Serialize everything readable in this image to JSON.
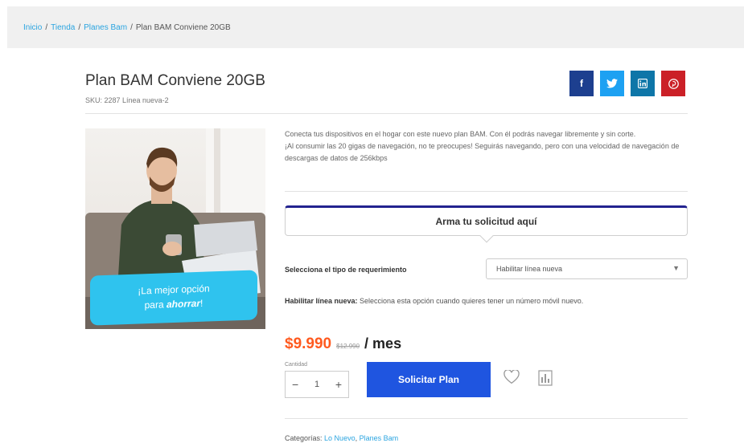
{
  "breadcrumb": {
    "items": [
      "Inicio",
      "Tienda",
      "Planes Bam"
    ],
    "current": "Plan BAM Conviene 20GB",
    "separator": "/"
  },
  "product": {
    "title": "Plan BAM Conviene 20GB",
    "sku": "SKU: 2287 Línea nueva-2",
    "description": [
      "Conecta tus dispositivos en el hogar con este nuevo plan BAM.  Con él podrás navegar libremente y sin corte.",
      "¡Al consumir las 20 gigas de navegación, no te preocupes!  Seguirás navegando, pero con una velocidad de navegación de descargas de datos de 256kbps"
    ]
  },
  "share": [
    {
      "icon": "facebook-icon",
      "glyph": "f",
      "color": "#1d3f8f"
    },
    {
      "icon": "twitter-icon",
      "glyph": "t",
      "color": "#1da1f2"
    },
    {
      "icon": "linkedin-icon",
      "glyph": "in",
      "color": "#0e76a8"
    },
    {
      "icon": "pinterest-icon",
      "glyph": "p",
      "color": "#cb2027"
    }
  ],
  "hero_banner": {
    "line1": "¡La mejor opción",
    "line2_prefix": "para ",
    "line2_emph": "ahorrar",
    "line2_suffix": "!"
  },
  "request": {
    "header": "Arma tu solicitud aquí",
    "type_label": "Selecciona el tipo de requerimiento",
    "type_value": "Habilitar línea nueva",
    "hint_title": "Habilitar línea nueva:",
    "hint_text": " Selecciona esta opción cuando quieres tener un número móvil nuevo."
  },
  "pricing": {
    "price": "$9.990",
    "old_price": "$12.990",
    "period": "/ mes"
  },
  "purchase": {
    "qty_label": "Cantidad",
    "qty_value": "1",
    "minus": "−",
    "plus": "+",
    "cta": "Solicitar Plan"
  },
  "categories": {
    "label": "Categorías:",
    "items": [
      "Lo Nuevo",
      "Planes Bam"
    ]
  },
  "colors": {
    "accent_blue": "#1f55e0",
    "price_orange": "#ff5a1f",
    "banner_cyan": "#2fc3ee",
    "header_navy": "#23238f"
  }
}
